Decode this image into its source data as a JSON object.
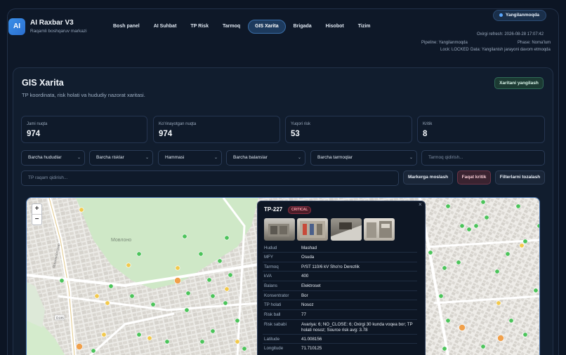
{
  "brand": {
    "logo": "AI",
    "title": "AI Raxbar V3",
    "subtitle": "Raqamli boshqaruv markazi"
  },
  "nav": [
    "Bosh panel",
    "AI Suhbat",
    "TP Risk",
    "Tarmoq",
    "GIS Xarita",
    "Brigada",
    "Hisobot",
    "Tizim"
  ],
  "nav_active": "GIS Xarita",
  "status": {
    "pill": "Yangilanmoqda",
    "last_refresh": "Oxirgi refresh: 2026-08-28 17:07:42",
    "pipeline": "Pipeline: Yangilanmoqda",
    "phase": "Phase: Noma'lum",
    "lock": "Lock: LOCKED",
    "data": "Data: Yangilanish jarayoni davom etmoqda"
  },
  "page": {
    "title": "GIS Xarita",
    "subtitle": "TP koordinata, risk holati va hududiy nazorat xaritasi.",
    "refresh_button": "Xaritani yangilash"
  },
  "stats": [
    {
      "label": "Jami nuqta",
      "value": "974"
    },
    {
      "label": "Ko'rinayotgan nuqta",
      "value": "974"
    },
    {
      "label": "Yuqori risk",
      "value": "53"
    },
    {
      "label": "Kritik",
      "value": "8"
    }
  ],
  "filters": {
    "region": "Barcha hududlar",
    "risk": "Barcha risklar",
    "all": "Hammasi",
    "balance": "Barcha balanslar",
    "network": "Barcha tarmoqlar",
    "network_search_placeholder": "Tarmoq qidirish...",
    "tp_search_placeholder": "TP raqam qidirish..."
  },
  "buttons": {
    "fit_markers": "Markerga moslash",
    "critical_only": "Faqat kritik",
    "clear_filters": "Filterlarni tozalash"
  },
  "map": {
    "zoom_in": "+",
    "zoom_out": "−",
    "place_label": "Мовлоно",
    "road_label_1": "Машиносозлар",
    "road_label_2": "D106"
  },
  "popup": {
    "tp": "TP-227",
    "badge": "CRITICAL",
    "close": "×",
    "rows": [
      {
        "label": "Hudud",
        "value": "Mashad"
      },
      {
        "label": "MFY",
        "value": "Osuda"
      },
      {
        "label": "Tarmoq",
        "value": "P/ST 110/6 kV Sho'ro Derezlik"
      },
      {
        "label": "kVA",
        "value": "400"
      },
      {
        "label": "Balans",
        "value": "Elektroset"
      },
      {
        "label": "Konsentrator",
        "value": "Bor"
      },
      {
        "label": "TP holati",
        "value": "Nosoz"
      },
      {
        "label": "Risk ball",
        "value": "77"
      },
      {
        "label": "Risk sababi",
        "value": "Avariya: 6; NO_CLOSE: 6; Oxirgi 30 kunda voqea bor; TP holati nosoz; Source risk avg: 3.78"
      },
      {
        "label": "Latitude",
        "value": "41.008156"
      },
      {
        "label": "Longitude",
        "value": "71.710125"
      }
    ]
  },
  "colors": {
    "accent": "#3b8fe8",
    "marker_green": "#4cc35a",
    "marker_yellow": "#f2c94c",
    "marker_orange": "#f0a04b",
    "critical": "#ff9aab"
  }
}
